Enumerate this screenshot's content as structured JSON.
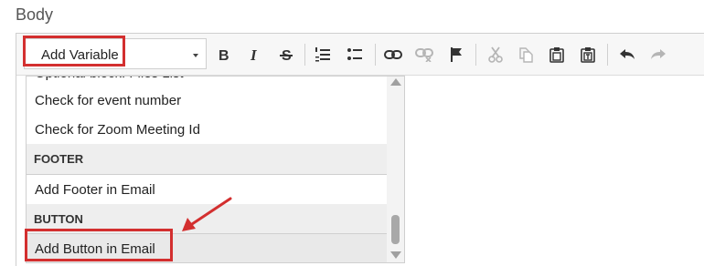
{
  "body_label": "Body",
  "toolbar": {
    "variable_select": {
      "label": "Add Variable"
    },
    "buttons": [
      {
        "icon": "bold-icon"
      },
      {
        "icon": "italic-icon"
      },
      {
        "icon": "strikethrough-icon"
      },
      {
        "icon": "numbered-list-icon"
      },
      {
        "icon": "bulleted-list-icon"
      },
      {
        "icon": "link-icon"
      },
      {
        "icon": "unlink-icon"
      },
      {
        "icon": "anchor-flag-icon"
      },
      {
        "icon": "cut-icon"
      },
      {
        "icon": "copy-icon"
      },
      {
        "icon": "paste-icon"
      },
      {
        "icon": "paste-text-icon"
      },
      {
        "icon": "undo-icon"
      },
      {
        "icon": "redo-icon"
      }
    ]
  },
  "dropdown": {
    "items": [
      {
        "label": "Optional block: Files List",
        "type": "item"
      },
      {
        "label": "Check for event number",
        "type": "item"
      },
      {
        "label": "Check for Zoom Meeting Id",
        "type": "item"
      },
      {
        "label": "FOOTER",
        "type": "header"
      },
      {
        "label": "Add Footer in Email",
        "type": "item"
      },
      {
        "label": "BUTTON",
        "type": "header"
      },
      {
        "label": "Add Button in Email",
        "type": "item",
        "highlighted": true
      }
    ]
  },
  "annotation_color": "#d32f2f"
}
